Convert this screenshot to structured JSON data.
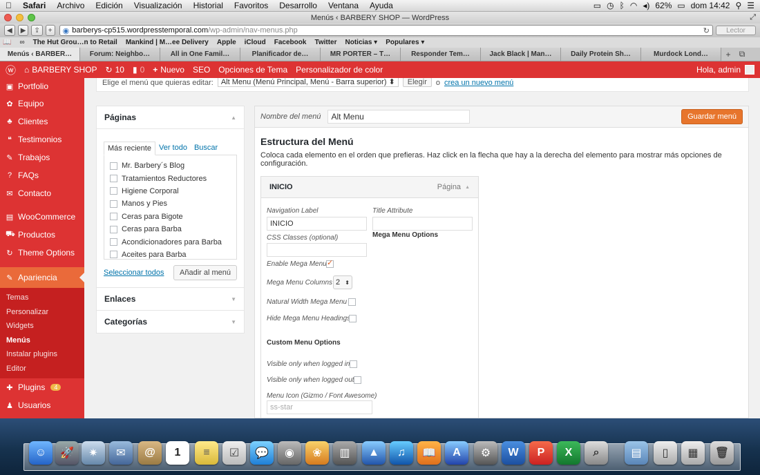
{
  "mac_menubar": {
    "apple": "",
    "items": [
      "Safari",
      "Archivo",
      "Edición",
      "Visualización",
      "Historial",
      "Favoritos",
      "Desarrollo",
      "Ventana",
      "Ayuda"
    ],
    "battery": "62%",
    "clock": "dom 14:42"
  },
  "window": {
    "title": "Menús ‹ BARBERY SHOP — WordPress"
  },
  "browser": {
    "url_domain": "barberys-cp515.wordpresstemporal.com",
    "url_path": "/wp-admin/nav-menus.php",
    "reader_label": "Lector",
    "bookmarks": [
      "The Hut Grou…n to Retail",
      "Mankind | M…ee Delivery",
      "Apple",
      "iCloud",
      "Facebook",
      "Twitter",
      "Noticias ▾",
      "Populares ▾"
    ],
    "tabs": [
      "Menús ‹ BARBER…",
      "Forum: Neighbo…",
      "All in One Famil…",
      "Planificador de…",
      "MR PORTER – T…",
      "Responder Tem…",
      "Jack Black | Man…",
      "Daily Protein Sh…",
      "Murdock Lond…"
    ]
  },
  "wp_adminbar": {
    "site": "BARBERY SHOP",
    "updates": "10",
    "comments": "0",
    "new": "Nuevo",
    "seo": "SEO",
    "theme_options": "Opciones de Tema",
    "color_customizer": "Personalizador de color",
    "greeting": "Hola, admin"
  },
  "sidebar": {
    "items_top": [
      {
        "label": "Portfolio",
        "icon": "▣"
      },
      {
        "label": "Equipo",
        "icon": "✿"
      },
      {
        "label": "Clientes",
        "icon": "♣"
      },
      {
        "label": "Testimonios",
        "icon": "❝"
      },
      {
        "label": "Trabajos",
        "icon": "✎"
      },
      {
        "label": "FAQs",
        "icon": "?"
      },
      {
        "label": "Contacto",
        "icon": "✉"
      }
    ],
    "items_mid": [
      {
        "label": "WooCommerce",
        "icon": "▤"
      },
      {
        "label": "Productos",
        "icon": "⛟"
      },
      {
        "label": "Theme Options",
        "icon": "↻"
      }
    ],
    "active": {
      "label": "Apariencia",
      "icon": "✎"
    },
    "submenu": [
      "Temas",
      "Personalizar",
      "Widgets",
      "Menús",
      "Instalar plugins",
      "Editor"
    ],
    "current_sub": "Menús",
    "plugins": {
      "label": "Plugins",
      "badge": "4",
      "icon": "✚"
    },
    "users": {
      "label": "Usuarios",
      "icon": "♟"
    }
  },
  "select_menu": {
    "prompt": "Elige el menú que quieras editar:",
    "selected": "Alt Menu (Menú Principal, Menú - Barra superior)",
    "button": "Elegir",
    "or": "o",
    "create_link": "crea un nuevo menú"
  },
  "pages_box": {
    "title": "Páginas",
    "tabs": [
      "Más reciente",
      "Ver todo",
      "Buscar"
    ],
    "items": [
      "Mr. Barbery´s Blog",
      "Tratamientos Reductores",
      "Higiene Corporal",
      "Manos y Pies",
      "Ceras para Bigote",
      "Ceras para Barba",
      "Acondicionadores para Barba",
      "Aceites para Barba"
    ],
    "select_all": "Seleccionar todos",
    "add_button": "Añadir al menú"
  },
  "links_box": {
    "title": "Enlaces"
  },
  "categories_box": {
    "title": "Categorías"
  },
  "menu_editor": {
    "name_label": "Nombre del menú",
    "name_value": "Alt Menu",
    "save_button": "Guardar menú",
    "structure_title": "Estructura del Menú",
    "structure_desc": "Coloca cada elemento en el orden que prefieras. Haz click en la flecha que hay a la derecha del elemento para mostrar más opciones de configuración.",
    "item": {
      "title": "INICIO",
      "type": "Página",
      "nav_label_label": "Navigation Label",
      "nav_label_value": "INICIO",
      "title_attr_label": "Title Attribute",
      "title_attr_value": "",
      "css_label": "CSS Classes (optional)",
      "css_value": "",
      "mega_options": "Mega Menu Options",
      "enable_mega": "Enable Mega Menu",
      "mega_columns_label": "Mega Menu Columns",
      "mega_columns_value": "2",
      "natural_width": "Natural Width Mega Menu",
      "hide_headings": "Hide Mega Menu Headings",
      "custom_options": "Custom Menu Options",
      "visible_in": "Visible only when logged in",
      "visible_out": "Visible only when logged out",
      "menu_icon_label": "Menu Icon (Gizmo / Font Awesome)",
      "menu_icon_placeholder": "ss-star"
    }
  },
  "colors": {
    "wp_red": "#dd3333",
    "active_orange": "#ea6a3a",
    "save_orange": "#e7752c",
    "link_blue": "#0073aa"
  }
}
